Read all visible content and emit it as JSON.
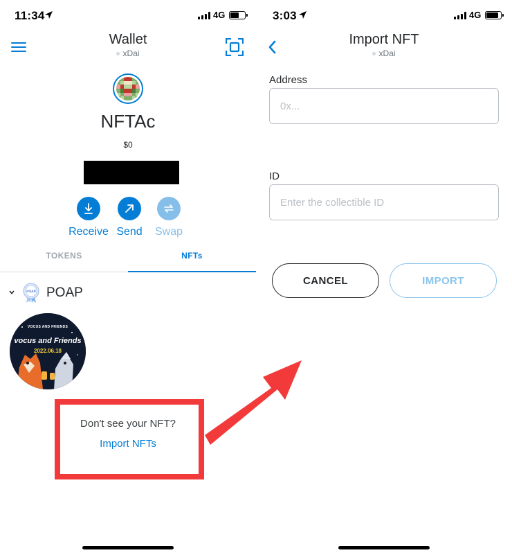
{
  "left_screen": {
    "status": {
      "time": "11:34",
      "network": "4G"
    },
    "header": {
      "title": "Wallet",
      "network": "xDai"
    },
    "account": {
      "name": "NFTAc",
      "balance": "$0"
    },
    "actions": [
      {
        "label": "Receive",
        "icon": "download-icon"
      },
      {
        "label": "Send",
        "icon": "send-arrow-icon"
      },
      {
        "label": "Swap",
        "icon": "swap-icon"
      }
    ],
    "tabs": {
      "tokens": "TOKENS",
      "nfts": "NFTs"
    },
    "collection": {
      "name": "POAP",
      "badge_text": "POAP",
      "nft": {
        "brand": "VOCUS AND FRIENDS",
        "title": "vocus and Friends",
        "date": "2022.06.18"
      }
    },
    "empty_prompt": {
      "question": "Don't see your NFT?",
      "link": "Import NFTs"
    }
  },
  "right_screen": {
    "status": {
      "time": "3:03",
      "network": "4G"
    },
    "header": {
      "title": "Import NFT",
      "network": "xDai"
    },
    "form": {
      "address_label": "Address",
      "address_placeholder": "0x...",
      "id_label": "ID",
      "id_placeholder": "Enter the collectible ID"
    },
    "buttons": {
      "cancel": "CANCEL",
      "import": "IMPORT"
    }
  },
  "colors": {
    "accent": "#037dd6",
    "accent_disabled": "#85bfe9",
    "highlight": "#f23a3a",
    "text": "#24272a",
    "muted": "#6a737d",
    "border": "#bbc0c5"
  }
}
